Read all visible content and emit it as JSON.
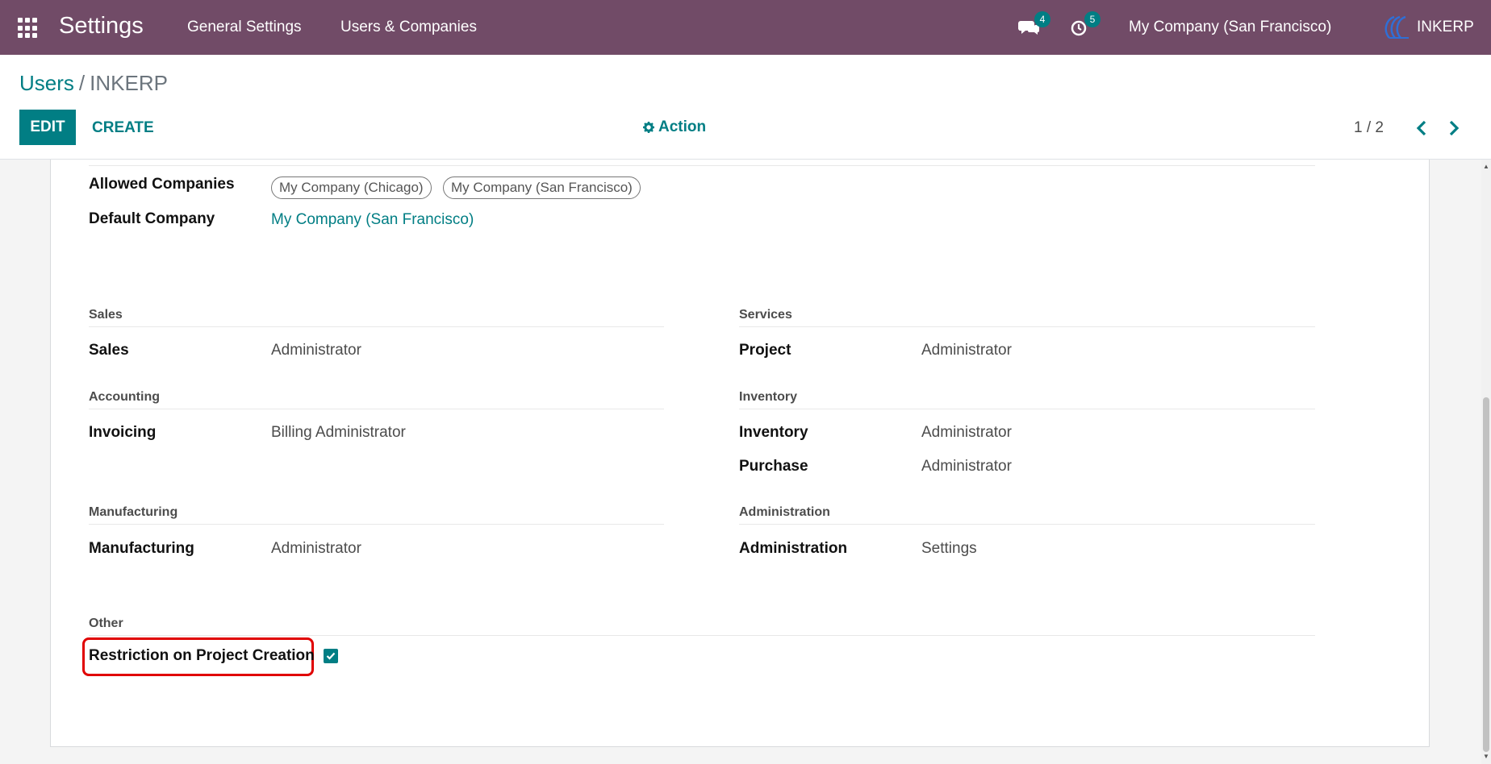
{
  "navbar": {
    "app_title": "Settings",
    "menu": [
      "General Settings",
      "Users & Companies"
    ],
    "messages_badge": "4",
    "activities_badge": "5",
    "company": "My Company (San Francisco)",
    "user": "INKERP"
  },
  "control_panel": {
    "breadcrumb_parent": "Users",
    "breadcrumb_sep": "/",
    "breadcrumb_current": "INKERP",
    "edit_label": "EDIT",
    "create_label": "CREATE",
    "action_label": "Action",
    "pager": "1 / 2"
  },
  "form": {
    "allowed_companies_label": "Allowed Companies",
    "allowed_companies": [
      "My Company (Chicago)",
      "My Company (San Francisco)"
    ],
    "default_company_label": "Default Company",
    "default_company": "My Company (San Francisco)",
    "groups": {
      "sales": {
        "title": "Sales",
        "label": "Sales",
        "value": "Administrator"
      },
      "services": {
        "title": "Services",
        "label": "Project",
        "value": "Administrator"
      },
      "accounting": {
        "title": "Accounting",
        "label": "Invoicing",
        "value": "Billing Administrator"
      },
      "inventory": {
        "title": "Inventory",
        "fields": [
          {
            "label": "Inventory",
            "value": "Administrator"
          },
          {
            "label": "Purchase",
            "value": "Administrator"
          }
        ]
      },
      "manufacturing": {
        "title": "Manufacturing",
        "label": "Manufacturing",
        "value": "Administrator"
      },
      "administration": {
        "title": "Administration",
        "label": "Administration",
        "value": "Settings"
      },
      "other": {
        "title": "Other",
        "label": "Restriction on Project Creation",
        "checked": true
      }
    }
  },
  "colors": {
    "navbar": "#714b67",
    "accent": "#017e84",
    "highlight": "#e00000"
  }
}
